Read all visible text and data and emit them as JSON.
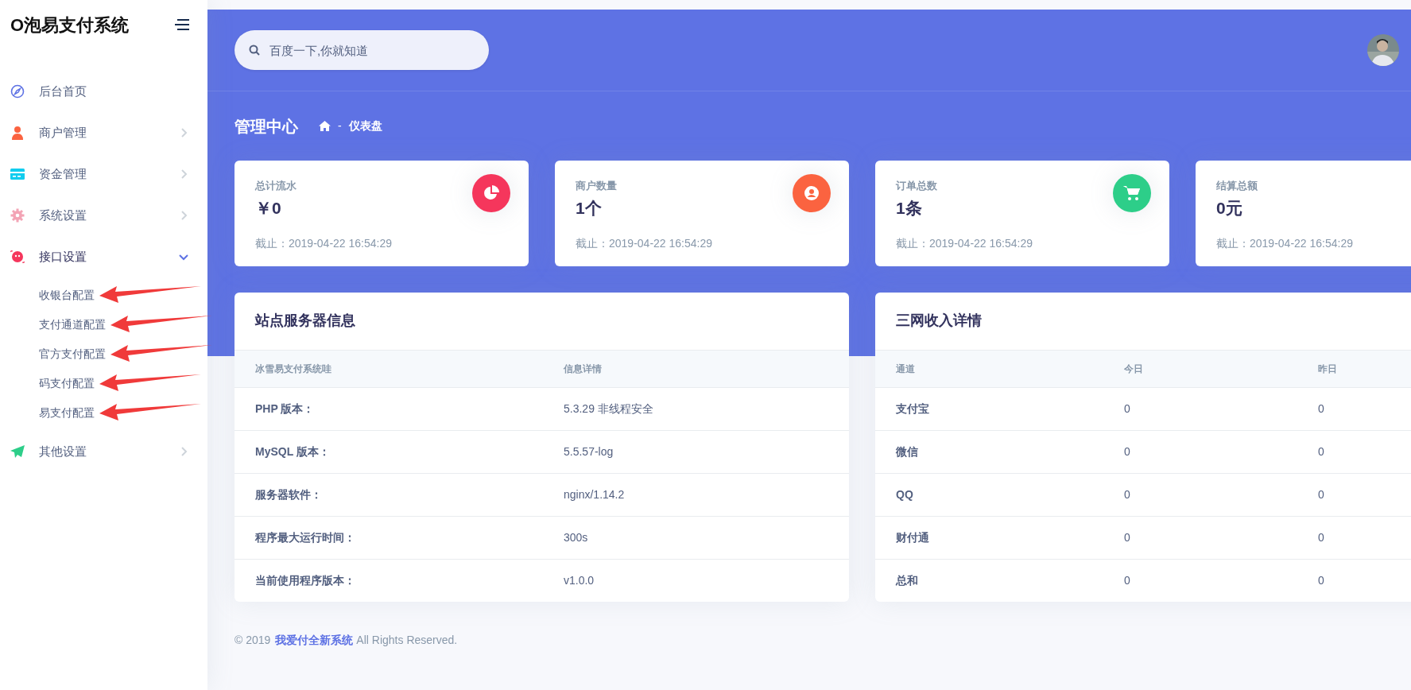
{
  "brand": {
    "title": "O泡易支付系统"
  },
  "sidebar": {
    "items": [
      {
        "label": "后台首页",
        "kind": "link"
      },
      {
        "label": "商户管理",
        "kind": "group",
        "expanded": false
      },
      {
        "label": "资金管理",
        "kind": "group",
        "expanded": false
      },
      {
        "label": "系统设置",
        "kind": "group",
        "expanded": false
      },
      {
        "label": "接口设置",
        "kind": "group",
        "expanded": true,
        "children": [
          {
            "label": "收银台配置",
            "marked": true
          },
          {
            "label": "支付通道配置",
            "marked": true
          },
          {
            "label": "官方支付配置",
            "marked": true
          },
          {
            "label": "码支付配置",
            "marked": true
          },
          {
            "label": "易支付配置",
            "marked": true
          }
        ]
      },
      {
        "label": "其他设置",
        "kind": "group",
        "expanded": false
      }
    ]
  },
  "search": {
    "placeholder": "百度一下,你就知道"
  },
  "page": {
    "title": "管理中心",
    "breadcrumb_separator": "-",
    "breadcrumb": "仪表盘"
  },
  "stats": [
    {
      "label": "总计流水",
      "value": "￥0",
      "footer": "截止：2019-04-22 16:54:29",
      "color": "#f5365c"
    },
    {
      "label": "商户数量",
      "value": "1个",
      "footer": "截止：2019-04-22 16:54:29",
      "color": "#fb6340"
    },
    {
      "label": "订单总数",
      "value": "1条",
      "footer": "截止：2019-04-22 16:54:29",
      "color": "#2dce89"
    },
    {
      "label": "结算总额",
      "value": "0元",
      "footer": "截止：2019-04-22 16:54:29"
    }
  ],
  "server_info": {
    "title": "站点服务器信息",
    "columns": [
      "冰雪易支付系统哇",
      "信息详情"
    ],
    "rows": [
      [
        "PHP 版本：",
        "5.3.29 非线程安全"
      ],
      [
        "MySQL 版本：",
        "5.5.57-log"
      ],
      [
        "服务器软件：",
        "nginx/1.14.2"
      ],
      [
        "程序最大运行时间：",
        "300s"
      ],
      [
        "当前使用程序版本：",
        "v1.0.0"
      ]
    ]
  },
  "income": {
    "title": "三网收入详情",
    "columns": [
      "通道",
      "今日",
      "昨日"
    ],
    "rows": [
      [
        "支付宝",
        "0",
        "0"
      ],
      [
        "微信",
        "0",
        "0"
      ],
      [
        "QQ",
        "0",
        "0"
      ],
      [
        "财付通",
        "0",
        "0"
      ],
      [
        "总和",
        "0",
        "0"
      ]
    ]
  },
  "footer": {
    "prefix": "© 2019",
    "link": "我爱付全新系统",
    "suffix": "All Rights Reserved."
  }
}
